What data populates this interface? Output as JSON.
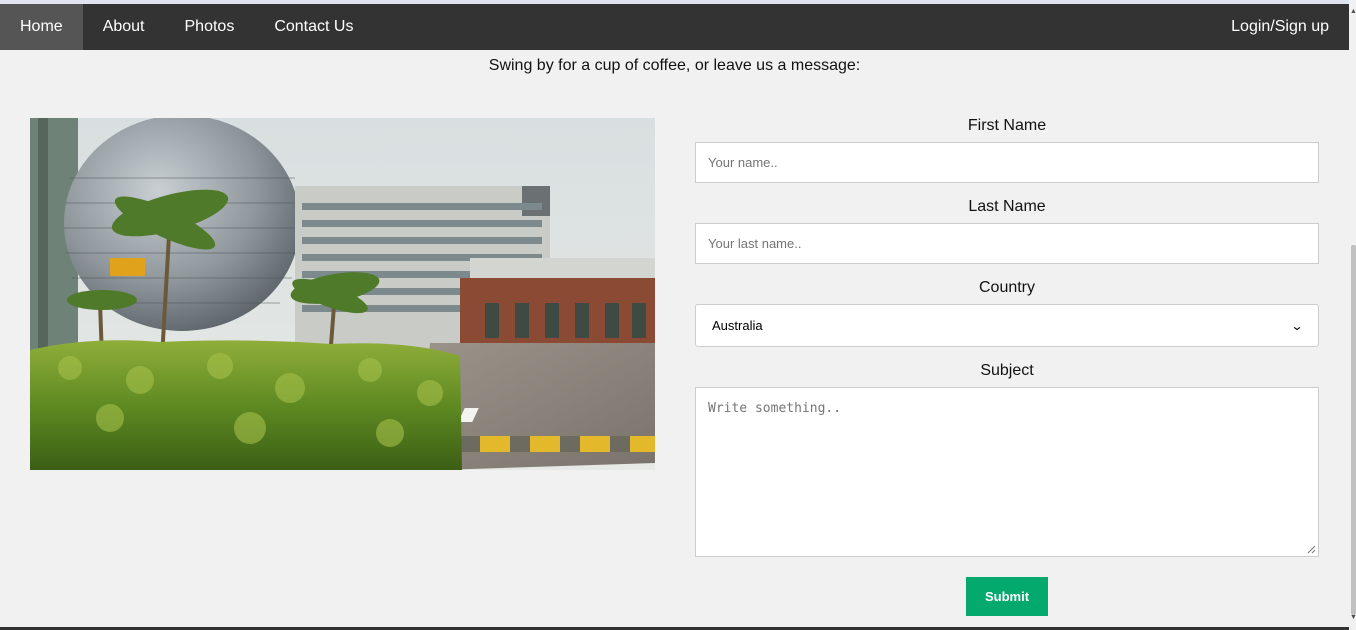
{
  "nav": {
    "items": [
      {
        "label": "Home",
        "active": true
      },
      {
        "label": "About",
        "active": false
      },
      {
        "label": "Photos",
        "active": false
      },
      {
        "label": "Contact Us",
        "active": false
      }
    ],
    "login_label": "Login/Sign up"
  },
  "tagline": "Swing by for a cup of coffee, or leave us a message:",
  "form": {
    "first_name_label": "First Name",
    "first_name_placeholder": "Your name..",
    "last_name_label": "Last Name",
    "last_name_placeholder": "Your last name..",
    "country_label": "Country",
    "country_selected": "Australia",
    "subject_label": "Subject",
    "subject_placeholder": "Write something..",
    "submit_label": "Submit"
  },
  "colors": {
    "navbar": "#333333",
    "nav_active": "#555555",
    "submit": "#04aa6d",
    "background": "#f1f1f1"
  },
  "icons": {
    "select_arrow": "chevron-down-icon"
  }
}
